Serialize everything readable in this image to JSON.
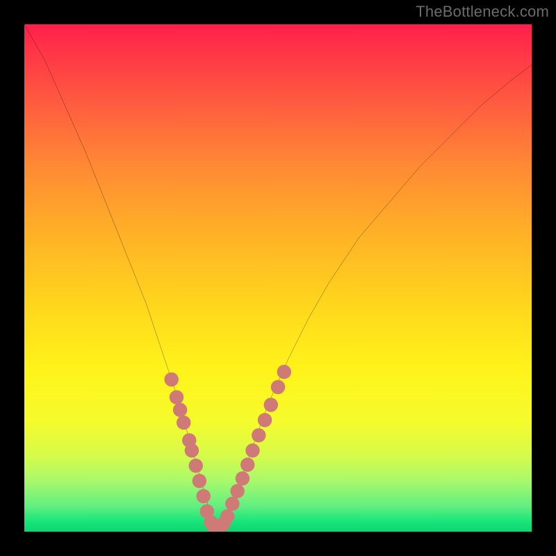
{
  "watermark": {
    "text": "TheBottleneck.com"
  },
  "chart_data": {
    "type": "line",
    "title": "",
    "xlabel": "",
    "ylabel": "",
    "xlim": [
      0,
      100
    ],
    "ylim": [
      0,
      100
    ],
    "grid": false,
    "legend": false,
    "curve": {
      "x": [
        0,
        4,
        8,
        12,
        16,
        20,
        24,
        28,
        30,
        32,
        34,
        36,
        37,
        38,
        40,
        42,
        44,
        48,
        52,
        56,
        60,
        66,
        72,
        78,
        84,
        90,
        96,
        100
      ],
      "y": [
        100,
        93,
        84,
        75,
        65,
        55,
        45,
        33,
        27,
        20,
        13,
        6,
        2,
        0.5,
        3,
        8,
        14,
        25,
        34,
        42,
        49,
        58,
        65,
        72,
        78,
        84,
        89,
        92
      ]
    },
    "beads": {
      "color": "#cf7a77",
      "radius": 1.4,
      "points": [
        {
          "x": 29.0,
          "y": 30.0
        },
        {
          "x": 30.0,
          "y": 26.5
        },
        {
          "x": 30.7,
          "y": 24.0
        },
        {
          "x": 31.4,
          "y": 21.5
        },
        {
          "x": 32.5,
          "y": 18.0
        },
        {
          "x": 33.0,
          "y": 16.0
        },
        {
          "x": 33.8,
          "y": 13.0
        },
        {
          "x": 34.5,
          "y": 10.0
        },
        {
          "x": 35.3,
          "y": 7.0
        },
        {
          "x": 36.0,
          "y": 4.0
        },
        {
          "x": 36.8,
          "y": 1.8
        },
        {
          "x": 37.5,
          "y": 0.6
        },
        {
          "x": 38.3,
          "y": 0.4
        },
        {
          "x": 39.2,
          "y": 1.5
        },
        {
          "x": 40.0,
          "y": 3.0
        },
        {
          "x": 41.0,
          "y": 5.5
        },
        {
          "x": 42.0,
          "y": 8.0
        },
        {
          "x": 43.0,
          "y": 10.5
        },
        {
          "x": 44.0,
          "y": 13.2
        },
        {
          "x": 45.0,
          "y": 16.0
        },
        {
          "x": 46.2,
          "y": 19.0
        },
        {
          "x": 47.4,
          "y": 22.0
        },
        {
          "x": 48.6,
          "y": 25.0
        },
        {
          "x": 50.0,
          "y": 28.5
        },
        {
          "x": 51.2,
          "y": 31.5
        }
      ]
    },
    "gradient_stops": [
      {
        "pos": 0,
        "color": "#ff1f4b"
      },
      {
        "pos": 6,
        "color": "#ff3846"
      },
      {
        "pos": 16,
        "color": "#ff5d3f"
      },
      {
        "pos": 28,
        "color": "#ff8a34"
      },
      {
        "pos": 42,
        "color": "#ffb326"
      },
      {
        "pos": 56,
        "color": "#ffd81c"
      },
      {
        "pos": 68,
        "color": "#fff31a"
      },
      {
        "pos": 78,
        "color": "#f6fb2c"
      },
      {
        "pos": 85,
        "color": "#d6fb4a"
      },
      {
        "pos": 90,
        "color": "#a8f96c"
      },
      {
        "pos": 95,
        "color": "#62ee80"
      },
      {
        "pos": 98,
        "color": "#17e57a"
      },
      {
        "pos": 100,
        "color": "#0ed56f"
      }
    ]
  }
}
